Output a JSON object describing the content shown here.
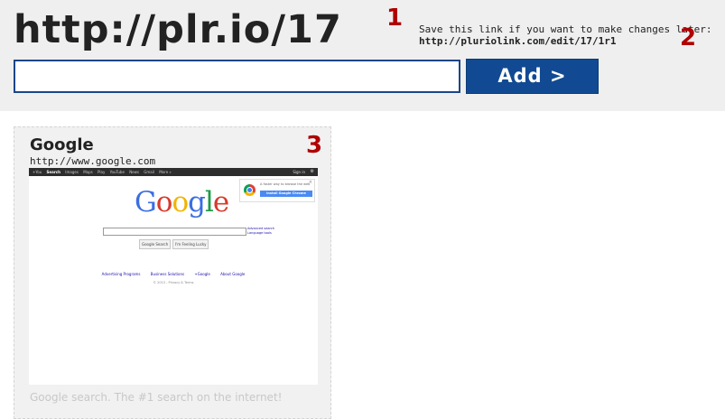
{
  "header": {
    "short_url": "http://plr.io/17",
    "edit_note": "Save this link if you want to make changes later:",
    "edit_link": "http://pluriolink.com/edit/17/1r1",
    "add_button_label": "Add >",
    "url_input_value": "",
    "markers": [
      "1",
      "2",
      "3"
    ]
  },
  "card": {
    "title": "Google",
    "url": "http://www.google.com",
    "description": "Google search. The #1 search on the internet!",
    "thumbnail": {
      "bar_items": [
        "+You",
        "Search",
        "Images",
        "Maps",
        "Play",
        "YouTube",
        "News",
        "Gmail",
        "More »"
      ],
      "sign_in": "Sign in",
      "logo_letters": [
        {
          "ch": "G",
          "color": "#3b6ee0"
        },
        {
          "ch": "o",
          "color": "#d73a2b"
        },
        {
          "ch": "o",
          "color": "#f0b400"
        },
        {
          "ch": "g",
          "color": "#3b6ee0"
        },
        {
          "ch": "l",
          "color": "#1f9a45"
        },
        {
          "ch": "e",
          "color": "#d73a2b"
        }
      ],
      "popup_text": "A faster way to browse the web",
      "popup_button": "Install Google Chrome",
      "advanced_search": "Advanced search",
      "language_tools": "Language tools",
      "search_button": "Google Search",
      "lucky_button": "I'm Feeling Lucky",
      "footer_links": [
        "Advertising Programs",
        "Business Solutions",
        "+Google",
        "About Google"
      ],
      "copyright": "© 2013 - Privacy & Terms"
    }
  },
  "colors": {
    "accent": "#114a92",
    "marker": "#b00000",
    "topbar_bg": "#efefef"
  }
}
